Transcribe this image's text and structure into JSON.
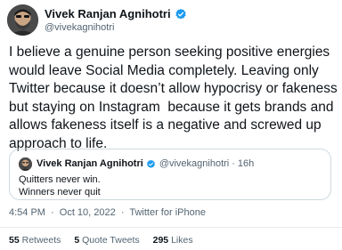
{
  "author": {
    "display_name": "Vivek Ranjan Agnihotri",
    "handle": "@vivekagnihotri"
  },
  "body": "I believe a genuine person seeking positive energies would leave Social Media completely. Leaving only Twitter because it doesn’t allow hypocrisy or fakeness but staying on Instagram  because it gets brands and allows fakeness itself is a negative and screwed up approach to life.",
  "quoted_tweet": {
    "display_name": "Vivek Ranjan Agnihotri",
    "handle": "@vivekagnihotri",
    "separator": "·",
    "time": "16h",
    "line1": "Quitters never win.",
    "line2": "Winners never quit"
  },
  "meta": {
    "time": "4:54 PM",
    "separator": "·",
    "date": "Oct 10, 2022",
    "source": "Twitter for iPhone"
  },
  "stats": {
    "retweets_count": "55",
    "retweets_label": "Retweets",
    "quotes_count": "5",
    "quotes_label": "Quote Tweets",
    "likes_count": "295",
    "likes_label": "Likes"
  },
  "colors": {
    "verified_blue": "#1d9bf0",
    "secondary_text": "#536471",
    "primary_text": "#0f1419"
  }
}
